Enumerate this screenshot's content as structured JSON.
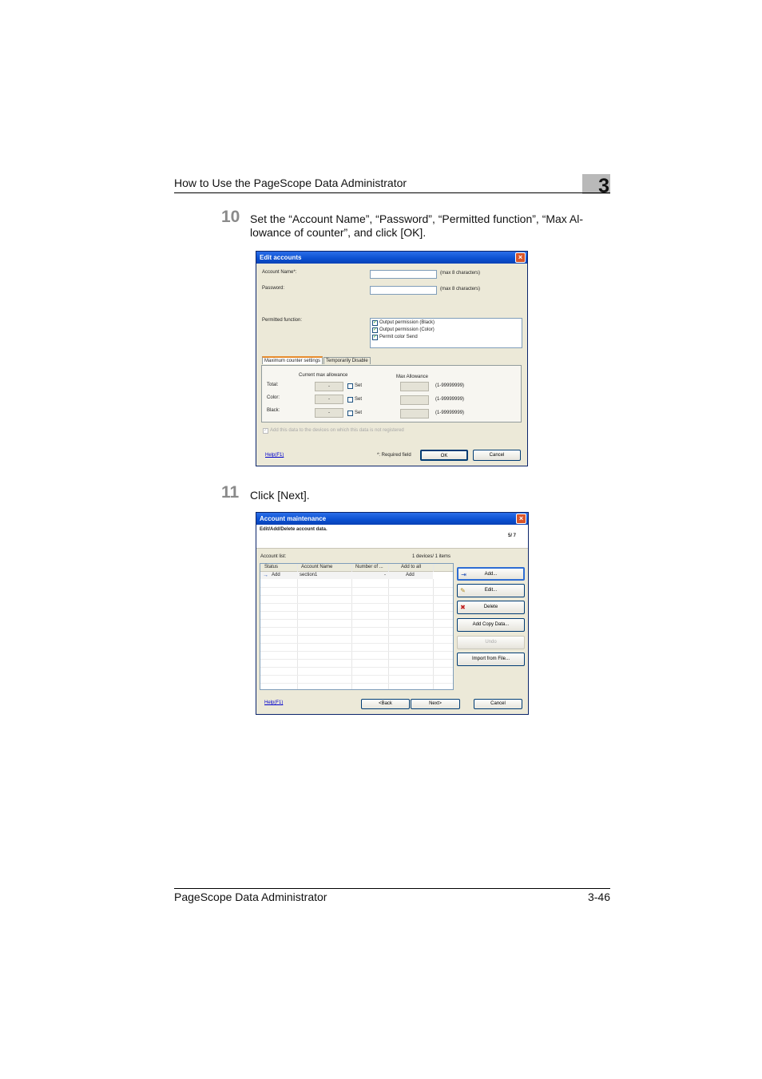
{
  "header": {
    "title": "How to Use the PageScope Data Administrator",
    "chapter": "3"
  },
  "footer": {
    "left": "PageScope Data Administrator",
    "right": "3-46"
  },
  "step10": {
    "number": "10",
    "text": "Set the “Account Name”, “Password”, “Permitted function”, “Max Al-lowance of counter”, and click [OK]."
  },
  "step11": {
    "number": "11",
    "text": "Click [Next]."
  },
  "edit_accounts": {
    "title": "Edit accounts",
    "account_name_label": "Account Name*:",
    "account_name_hint": "(max 8 characters)",
    "password_label": "Password:",
    "password_hint": "(max 8 characters)",
    "permitted_label": "Permitted function:",
    "permissions": [
      "Output permission (Black)",
      "Output permission (Color)",
      "Permit color Send"
    ],
    "tabs": [
      "Maximum counter settings",
      "Temporarily Disable"
    ],
    "current_max_header": "Current max allowance",
    "max_allowance_header": "Max Allowance",
    "rows": [
      {
        "label": "Total:",
        "current": "-",
        "set": "Set",
        "range": "(1-99999999)"
      },
      {
        "label": "Color:",
        "current": "-",
        "set": "Set",
        "range": "(1-99999999)"
      },
      {
        "label": "Black:",
        "current": "-",
        "set": "Set",
        "range": "(1-99999999)"
      }
    ],
    "add_devices_text": "Add this data to the devices on which this data is not registered",
    "help": "Help(F1)",
    "required": "*: Required field",
    "ok": "OK",
    "cancel": "Cancel"
  },
  "account_maintenance": {
    "title": "Account maintenance",
    "subtitle": "Edit/Add/Delete account data.",
    "page": "5/ 7",
    "list_label": "Account list:",
    "count": "1 devices/ 1 items",
    "columns": [
      "Status",
      "Account Name",
      "Number of ...",
      "Add to all"
    ],
    "rows": [
      {
        "status": "Add",
        "name": "section1",
        "number": "-",
        "add_all": "Add"
      }
    ],
    "buttons": {
      "add": "Add...",
      "edit": "Edit...",
      "delete": "Delete",
      "add_copy": "Add Copy Data...",
      "undo": "Undo",
      "import": "Import from File..."
    },
    "help": "Help(F1)",
    "back": "<Back",
    "next": "Next>",
    "cancel": "Cancel"
  }
}
